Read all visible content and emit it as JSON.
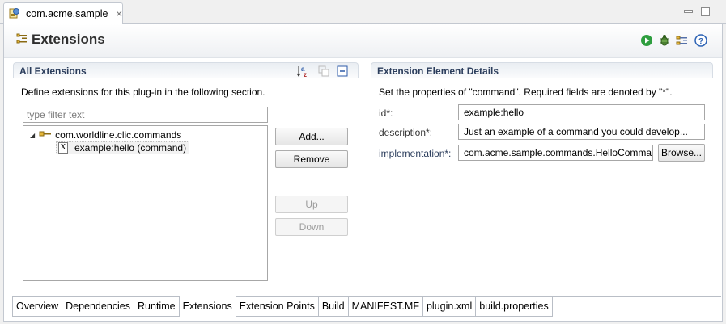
{
  "editor_tab": {
    "title": "com.acme.sample",
    "close": "✕"
  },
  "page": {
    "title": "Extensions"
  },
  "all_extensions": {
    "title": "All Extensions",
    "description": "Define extensions for this plug-in in the following section.",
    "filter_placeholder": "type filter text",
    "tree": {
      "root_label": "com.worldline.clic.commands",
      "child_label": "example:hello (command)",
      "child_badge": "X"
    },
    "buttons": {
      "add": "Add...",
      "remove": "Remove",
      "up": "Up",
      "down": "Down"
    }
  },
  "details": {
    "title": "Extension Element Details",
    "description": "Set the properties of \"command\". Required fields are denoted by \"*\".",
    "fields": {
      "id": {
        "label": "id*:",
        "value": "example:hello"
      },
      "description": {
        "label": "description*:",
        "value": "Just an example of a command you could develop..."
      },
      "implementation": {
        "label": "implementation*:",
        "value": "com.acme.sample.commands.HelloCommand",
        "browse": "Browse..."
      }
    }
  },
  "page_tabs": [
    "Overview",
    "Dependencies",
    "Runtime",
    "Extensions",
    "Extension Points",
    "Build",
    "MANIFEST.MF",
    "plugin.xml",
    "build.properties"
  ],
  "active_tab": "Extensions",
  "colors": {
    "section_title": "#2b3d5c",
    "run_icon": "#2e9e3f",
    "help_icon": "#2d63b5"
  }
}
